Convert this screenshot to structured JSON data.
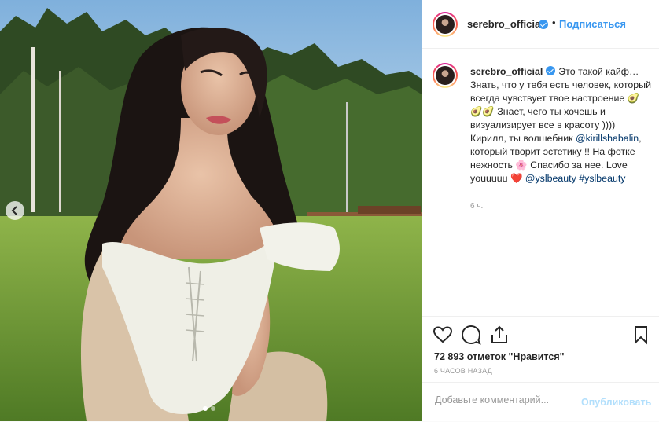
{
  "post": {
    "username": "serebro_official",
    "follow_label": "Подписаться",
    "separator": "•",
    "caption": {
      "text1": "Это такой кайф… Знать, что у тебя есть человек, который всегда чувствует твое настроение 🥑🥑🥑 Знает, чего ты хочешь и визуализирует все в красоту )))) Кирилл, ты волшебник ",
      "mention1": "@kirillshabalin",
      "text2": ", который творит эстетику !! На фотке нежность 🌸 Спасибо за нее. Love youuuuu ❤️ ",
      "mention2": "@yslbeauty",
      "hashtag": "#yslbeauty"
    },
    "caption_time": "6 ч.",
    "likes": "72 893 отметок \"Нравится\"",
    "posted_ago": "6 ЧАСОВ НАЗАД",
    "comment_placeholder": "Добавьте комментарий...",
    "publish_label": "Опубликовать"
  },
  "carousel": {
    "current": 1,
    "total": 2
  },
  "icons": {
    "like": "heart-icon",
    "comment": "comment-icon",
    "share": "share-icon",
    "save": "bookmark-icon",
    "prev": "chevron-left-icon"
  },
  "colors": {
    "accent": "#3897f0",
    "link": "#003569",
    "muted": "#999999"
  }
}
